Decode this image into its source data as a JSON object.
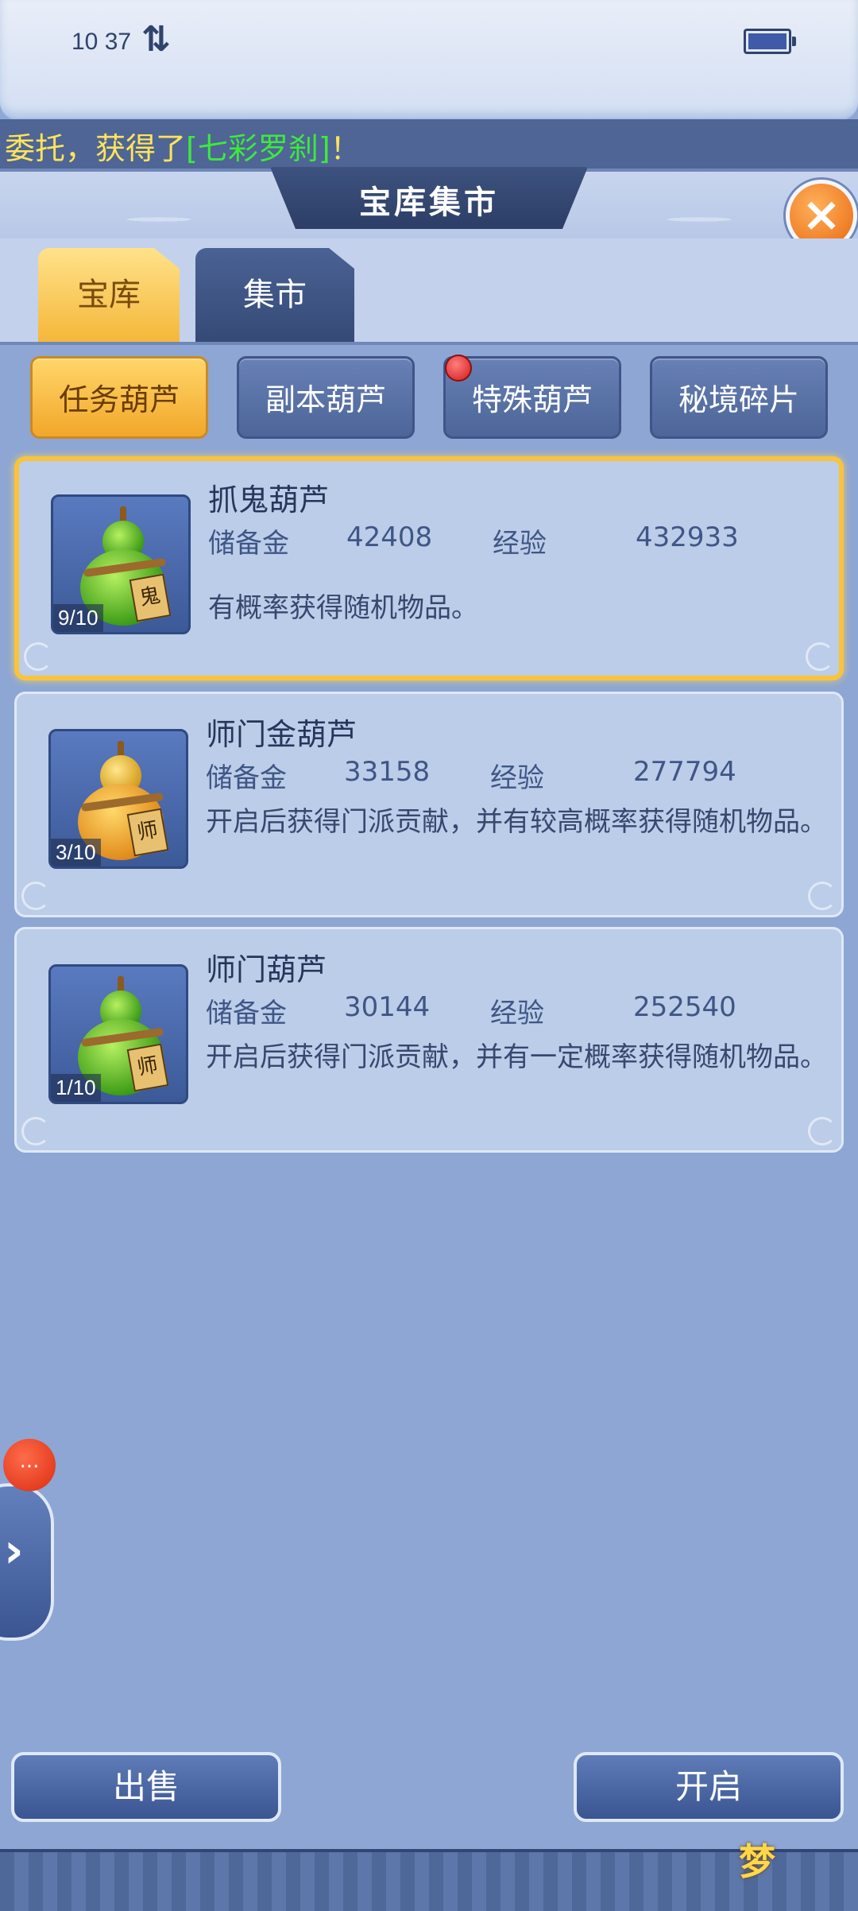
{
  "status_bar": {
    "time": "10 37",
    "network_icon": "data-transfer-arrows-icon",
    "battery_icon": "battery-icon"
  },
  "marquee": {
    "prefix": "委托，获得了",
    "highlight": "[七彩罗刹]",
    "suffix": "！"
  },
  "header": {
    "title": "宝库集市",
    "close_icon": "close-icon"
  },
  "tabs": [
    {
      "label": "宝库"
    },
    {
      "label": "集市"
    }
  ],
  "sub_tabs": [
    {
      "label": "任务葫芦",
      "active": true
    },
    {
      "label": "副本葫芦",
      "active": false
    },
    {
      "label": "特殊葫芦",
      "active": false,
      "badge": true
    },
    {
      "label": "秘境碎片",
      "active": false
    }
  ],
  "items": [
    {
      "name": "抓鬼葫芦",
      "reserve_label": "储备金",
      "reserve": "42408",
      "exp_label": "经验",
      "exp": "432933",
      "desc": "有概率获得随机物品。",
      "count": "9/10",
      "tag": "鬼",
      "color": "green"
    },
    {
      "name": "师门金葫芦",
      "reserve_label": "储备金",
      "reserve": "33158",
      "exp_label": "经验",
      "exp": "277794",
      "desc": "开启后获得门派贡献，并有较高概率获得随机物品。",
      "count": "3/10",
      "tag": "师",
      "color": "gold"
    },
    {
      "name": "师门葫芦",
      "reserve_label": "储备金",
      "reserve": "30144",
      "exp_label": "经验",
      "exp": "252540",
      "desc": "开启后获得门派贡献，并有一定概率获得随机物品。",
      "count": "1/10",
      "tag": "师",
      "color": "green"
    }
  ],
  "side": {
    "badge": "...",
    "arrow": "›"
  },
  "buttons": {
    "sell": "出售",
    "open": "开启"
  },
  "colors": {
    "accent_gold": "#f7c43c",
    "panel_blue": "#8da6d4",
    "text_dark": "#25365a"
  }
}
